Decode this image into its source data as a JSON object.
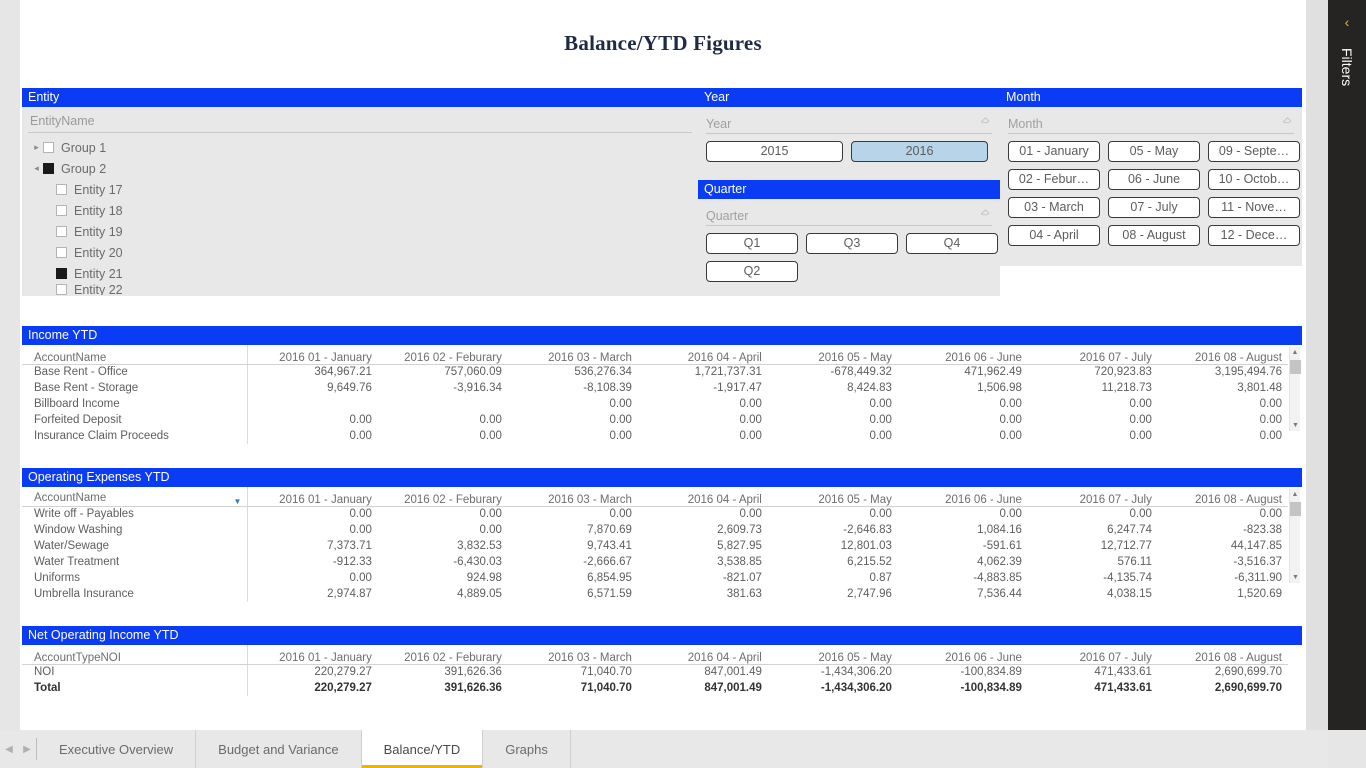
{
  "report": {
    "title": "Balance/YTD Figures"
  },
  "filters_pane": {
    "label": "Filters",
    "collapse_icon": "chevron-left-icon"
  },
  "entity_slicer": {
    "header": "Entity",
    "field_label": "EntityName",
    "items": [
      {
        "label": "Group 1",
        "level": 0,
        "checked": false,
        "expander": "▸",
        "clipped": false
      },
      {
        "label": "Group 2",
        "level": 0,
        "checked": true,
        "expander": "◂",
        "clipped": false
      },
      {
        "label": "Entity 17",
        "level": 1,
        "checked": false,
        "expander": "",
        "clipped": false
      },
      {
        "label": "Entity 18",
        "level": 1,
        "checked": false,
        "expander": "",
        "clipped": false
      },
      {
        "label": "Entity 19",
        "level": 1,
        "checked": false,
        "expander": "",
        "clipped": false
      },
      {
        "label": "Entity 20",
        "level": 1,
        "checked": false,
        "expander": "",
        "clipped": false
      },
      {
        "label": "Entity 21",
        "level": 1,
        "checked": true,
        "expander": "",
        "clipped": false
      },
      {
        "label": "Entity 22",
        "level": 1,
        "checked": false,
        "expander": "",
        "clipped": true
      }
    ]
  },
  "year_slicer": {
    "header": "Year",
    "field_label": "Year",
    "clear_icon": "eraser-icon",
    "options": [
      {
        "label": "2015",
        "selected": false
      },
      {
        "label": "2016",
        "selected": true
      }
    ]
  },
  "quarter_slicer": {
    "header": "Quarter",
    "field_label": "Quarter",
    "clear_icon": "eraser-icon",
    "row1": [
      {
        "label": "Q1",
        "selected": false
      },
      {
        "label": "Q3",
        "selected": false
      },
      {
        "label": "Q4",
        "selected": false
      }
    ],
    "row2": [
      {
        "label": "Q2",
        "selected": false
      }
    ]
  },
  "month_slicer": {
    "header": "Month",
    "field_label": "Month",
    "clear_icon": "eraser-icon",
    "col1": [
      {
        "label": "01 - January",
        "selected": false
      },
      {
        "label": "02 - Febur…",
        "selected": false
      },
      {
        "label": "03 - March",
        "selected": false
      },
      {
        "label": "04 - April",
        "selected": false
      }
    ],
    "col2": [
      {
        "label": "05 - May",
        "selected": false
      },
      {
        "label": "06 - June",
        "selected": false
      },
      {
        "label": "07 - July",
        "selected": false
      },
      {
        "label": "08 - August",
        "selected": false
      }
    ],
    "col3": [
      {
        "label": "09 - Septe…",
        "selected": false
      },
      {
        "label": "10 - Octob…",
        "selected": false
      },
      {
        "label": "11 - Nove…",
        "selected": false
      },
      {
        "label": "12 - Dece…",
        "selected": false
      }
    ]
  },
  "month_columns": [
    "2016 01 - January",
    "2016 02 - Feburary",
    "2016 03 - March",
    "2016 04 - April",
    "2016 05 - May",
    "2016 06 - June",
    "2016 07 - July",
    "2016 08 - August"
  ],
  "income_table": {
    "header": "Income YTD",
    "row_header": "AccountName",
    "sorted": false,
    "rows": [
      {
        "name": "Base Rent - Office",
        "values": [
          "364,967.21",
          "757,060.09",
          "536,276.34",
          "1,721,737.31",
          "-678,449.32",
          "471,962.49",
          "720,923.83",
          "3,195,494.76"
        ],
        "clipped": false
      },
      {
        "name": "Base Rent - Storage",
        "values": [
          "9,649.76",
          "-3,916.34",
          "-8,108.39",
          "-1,917.47",
          "8,424.83",
          "1,506.98",
          "11,218.73",
          "3,801.48"
        ],
        "clipped": false
      },
      {
        "name": "Billboard Income",
        "values": [
          "",
          "",
          "0.00",
          "0.00",
          "0.00",
          "0.00",
          "0.00",
          "0.00"
        ],
        "clipped": false
      },
      {
        "name": "Forfeited Deposit",
        "values": [
          "0.00",
          "0.00",
          "0.00",
          "0.00",
          "0.00",
          "0.00",
          "0.00",
          "0.00"
        ],
        "clipped": false
      },
      {
        "name": "Insurance Claim Proceeds",
        "values": [
          "0.00",
          "0.00",
          "0.00",
          "0.00",
          "0.00",
          "0.00",
          "0.00",
          "0.00"
        ],
        "clipped": true
      }
    ]
  },
  "opex_table": {
    "header": "Operating Expenses YTD",
    "row_header": "AccountName",
    "sorted": true,
    "sort_icon": "sort-descending-icon",
    "rows": [
      {
        "name": "Write off - Payables",
        "values": [
          "0.00",
          "0.00",
          "0.00",
          "0.00",
          "0.00",
          "0.00",
          "0.00",
          "0.00"
        ],
        "clipped": false
      },
      {
        "name": "Window Washing",
        "values": [
          "0.00",
          "0.00",
          "7,870.69",
          "2,609.73",
          "-2,646.83",
          "1,084.16",
          "6,247.74",
          "-823.38"
        ],
        "clipped": false
      },
      {
        "name": "Water/Sewage",
        "values": [
          "7,373.71",
          "3,832.53",
          "9,743.41",
          "5,827.95",
          "12,801.03",
          "-591.61",
          "12,712.77",
          "44,147.85"
        ],
        "clipped": false
      },
      {
        "name": "Water Treatment",
        "values": [
          "-912.33",
          "-6,430.03",
          "-2,666.67",
          "3,538.85",
          "6,215.52",
          "4,062.39",
          "576.11",
          "-3,516.37"
        ],
        "clipped": false
      },
      {
        "name": "Uniforms",
        "values": [
          "0.00",
          "924.98",
          "6,854.95",
          "-821.07",
          "0.87",
          "-4,883.85",
          "-4,135.74",
          "-6,311.90"
        ],
        "clipped": false
      },
      {
        "name": "Umbrella Insurance",
        "values": [
          "2,974.87",
          "4,889.05",
          "6,571.59",
          "381.63",
          "2,747.96",
          "7,536.44",
          "4,038.15",
          "1,520.69"
        ],
        "clipped": true
      }
    ]
  },
  "noi_table": {
    "header": "Net Operating Income YTD",
    "row_header": "AccountTypeNOI",
    "sorted": false,
    "rows": [
      {
        "name": "NOI",
        "values": [
          "220,279.27",
          "391,626.36",
          "71,040.70",
          "847,001.49",
          "-1,434,306.20",
          "-100,834.89",
          "471,433.61",
          "2,690,699.70"
        ],
        "total": false,
        "clipped": false
      },
      {
        "name": "Total",
        "values": [
          "220,279.27",
          "391,626.36",
          "71,040.70",
          "847,001.49",
          "-1,434,306.20",
          "-100,834.89",
          "471,433.61",
          "2,690,699.70"
        ],
        "total": true,
        "clipped": false
      }
    ]
  },
  "tabbar": {
    "prev_icon": "chevron-left-icon",
    "next_icon": "chevron-right-icon",
    "tabs": [
      {
        "label": "Executive Overview",
        "active": false
      },
      {
        "label": "Budget and Variance",
        "active": false
      },
      {
        "label": "Balance/YTD",
        "active": true
      },
      {
        "label": "Graphs",
        "active": false
      }
    ]
  },
  "scrollbar": {
    "up_icon": "chevron-up-icon",
    "down_icon": "chevron-down-icon"
  }
}
